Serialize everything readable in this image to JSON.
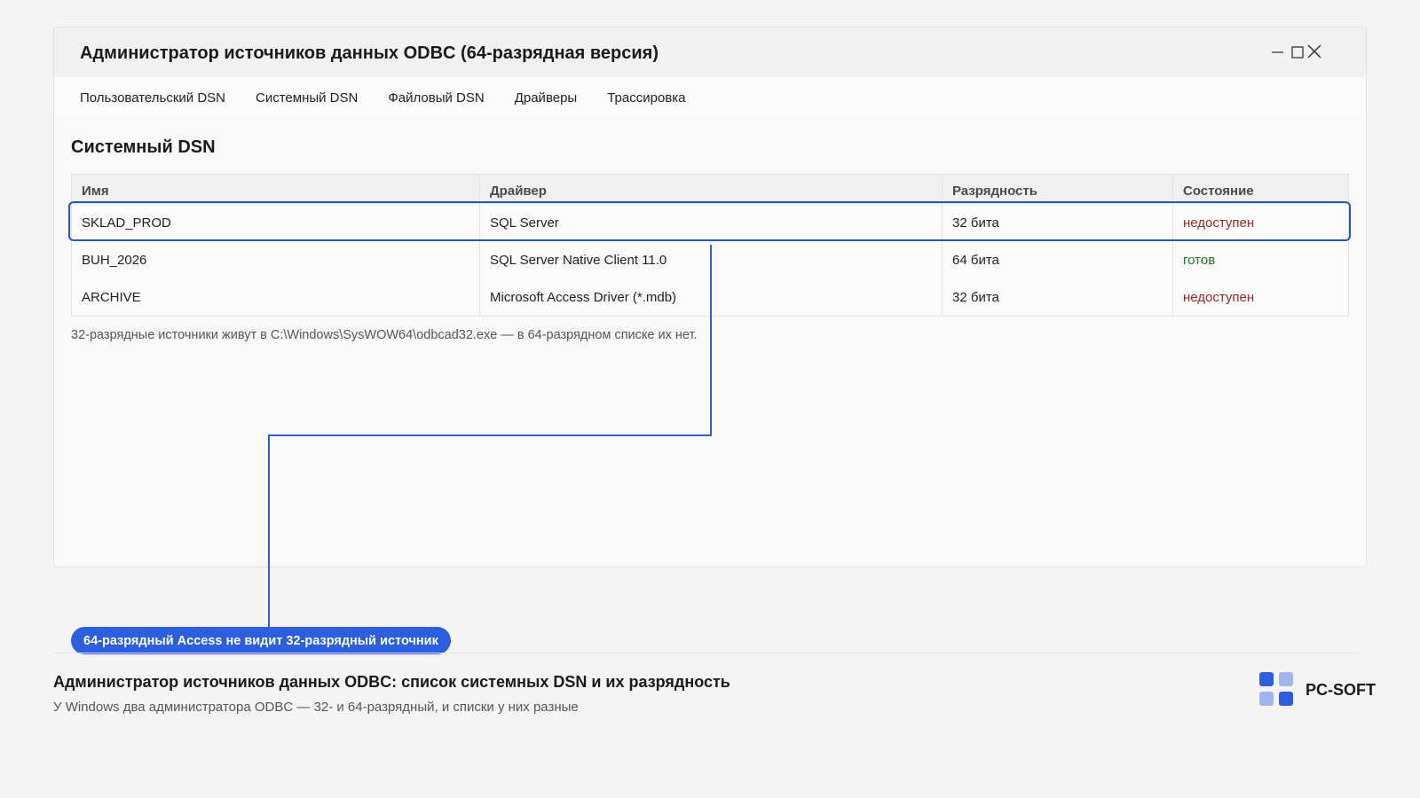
{
  "window": {
    "title": "Администратор источников данных ODBC (64-разрядная версия)",
    "tabs": [
      "Пользовательский DSN",
      "Системный DSN",
      "Файловый DSN",
      "Драйверы",
      "Трассировка"
    ],
    "active_tab": "Системный DSN"
  },
  "section": {
    "title": "Системный DSN"
  },
  "table": {
    "columns": [
      "Имя",
      "Драйвер",
      "Разрядность",
      "Состояние"
    ],
    "rows": [
      {
        "name": "SKLAD_PROD",
        "driver": "SQL Server",
        "bitness": "32 бита",
        "status": "недоступен",
        "status_kind": "bad",
        "highlighted": true
      },
      {
        "name": "BUH_2026",
        "driver": "SQL Server Native Client 11.0",
        "bitness": "64 бита",
        "status": "готов",
        "status_kind": "ok",
        "highlighted": false
      },
      {
        "name": "ARCHIVE",
        "driver": "Microsoft Access Driver (*.mdb)",
        "bitness": "32 бита",
        "status": "недоступен",
        "status_kind": "bad",
        "highlighted": false
      }
    ]
  },
  "note": "32-разрядные источники живут в C:\\Windows\\SysWOW64\\odbcad32.exe — в 64-разрядном списке их нет.",
  "callout": "64-разрядный Access не видит 32-разрядный источник",
  "caption": {
    "title": "Администратор источников данных ODBC: список системных DSN и их разрядность",
    "subtitle": "У Windows два администратора ODBC — 32- и 64-разрядный, и списки у них разные"
  },
  "brand": {
    "name": "PC-SOFT"
  },
  "icons": {
    "minimize": "minimize-icon",
    "maximize": "maximize-icon",
    "close": "close-icon"
  },
  "colors": {
    "accent": "#2b5fe0",
    "highlight_border": "#2356c9",
    "status_bad": "#a02828",
    "status_ok": "#1d7a2a",
    "logo_dark": "#2b5fe0",
    "logo_light": "#9fb5ef"
  }
}
